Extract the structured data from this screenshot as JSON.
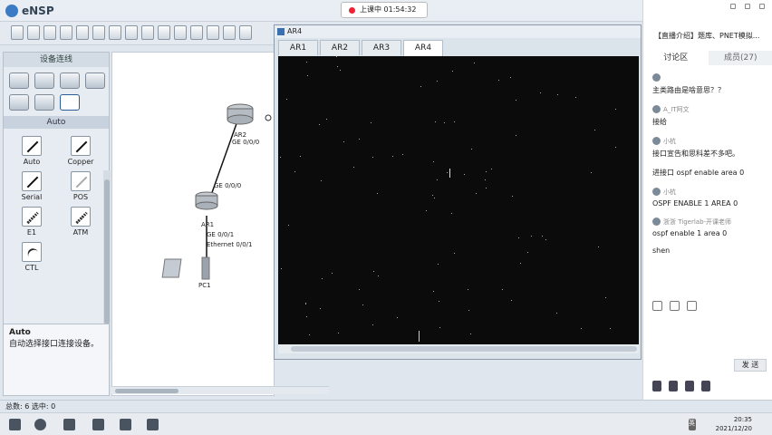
{
  "app": {
    "title": "eNSP"
  },
  "live": {
    "status": "上课中 01:54:32"
  },
  "device_panel": {
    "title": "设备连线",
    "cable_group": "Auto",
    "cables": [
      "Auto",
      "Copper",
      "Serial",
      "POS",
      "E1",
      "ATM",
      "CTL"
    ],
    "description_title": "Auto",
    "description": "自动选择接口连接设备。"
  },
  "topology": {
    "nodes": {
      "ar2": "AR2",
      "ar1": "AR1",
      "pc1": "PC1"
    },
    "ports": {
      "ar2_down": "GE 0/0/0",
      "ar1_up": "GE 0/0/0",
      "ar1_down": "GE 0/0/1",
      "pc1_up": "Ethernet 0/0/1"
    }
  },
  "console": {
    "window_title": "AR4",
    "tabs": [
      "AR1",
      "AR2",
      "AR3",
      "AR4"
    ],
    "active_tab": "AR4"
  },
  "chat": {
    "room_title": "【直播介绍】题库、PNET模拟...",
    "tabs": [
      "讨论区",
      "成员(27)"
    ],
    "messages": [
      {
        "name": "",
        "text": "主类路由是啥意思？？"
      },
      {
        "name": "A_IT阿文",
        "text": "接给"
      },
      {
        "name": "小杭",
        "text": "接口宣告和思科差不多吧。"
      },
      {
        "name": "",
        "text": "进接口 ospf enable area 0"
      },
      {
        "name": "小杭",
        "text": "OSPF ENABLE 1 AREA 0"
      },
      {
        "name": "浙浙 Tigerlab-开课老师",
        "text": "ospf enable 1 area 0"
      },
      {
        "name": "",
        "text": "shen"
      }
    ],
    "send": "发 送"
  },
  "status": {
    "text": "总数: 6 选中: 0"
  },
  "taskbar": {
    "time": "20:35",
    "date": "2021/12/20",
    "ime": "英"
  },
  "colors": {
    "terminal_bg": "#0a0b0a",
    "accent": "#3a6fb2"
  }
}
